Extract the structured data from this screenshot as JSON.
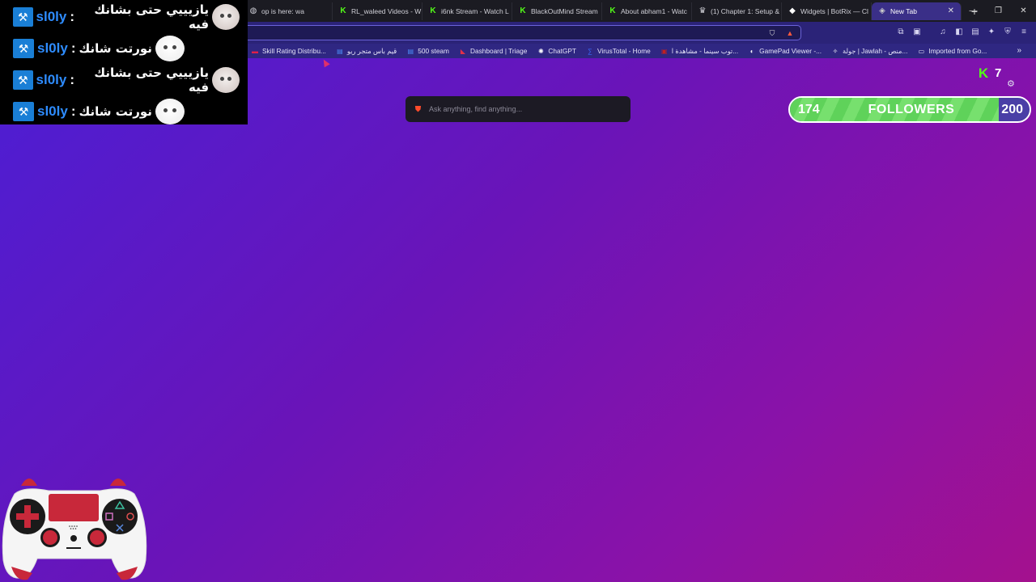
{
  "browser": {
    "tabs": [
      {
        "label": "op is here: wa",
        "icon": "globe-icon",
        "color": "#cfcfd6"
      },
      {
        "label": "RL_waleed Videos - W",
        "icon": "kick-icon",
        "color": "#53fc18"
      },
      {
        "label": "i6nk Stream - Watch L",
        "icon": "kick-icon",
        "color": "#53fc18"
      },
      {
        "label": "BlackOutMind Stream",
        "icon": "kick-icon",
        "color": "#53fc18"
      },
      {
        "label": "About abham1 - Watc",
        "icon": "kick-icon",
        "color": "#53fc18"
      },
      {
        "label": "(1) Chapter 1: Setup &",
        "icon": "crown-icon",
        "color": "#cfcfd6"
      },
      {
        "label": "Widgets | BotRix — Cl",
        "icon": "diamond-icon",
        "color": "#ffffff"
      }
    ],
    "active_tab": {
      "label": "New Tab",
      "close": "✕"
    },
    "new_tab": "+",
    "window_controls": {
      "minimize": "—",
      "restore": "❐",
      "close": "✕"
    }
  },
  "bookmarks": [
    {
      "label": "Skill Rating Distribu...",
      "icon": "tracker-icon",
      "color": "#e0204a"
    },
    {
      "label": "قيم باس متجر ريو",
      "icon": "doc-icon",
      "color": "#4b8bf5"
    },
    {
      "label": "500 steam",
      "icon": "doc-icon",
      "color": "#4b8bf5"
    },
    {
      "label": "Dashboard | Triage",
      "icon": "triage-icon",
      "color": "#e0304a"
    },
    {
      "label": "ChatGPT",
      "icon": "chatgpt-icon",
      "color": "#ffffff"
    },
    {
      "label": "VirusTotal - Home",
      "icon": "virustotal-icon",
      "color": "#3b6cff"
    },
    {
      "label": "توب سينما - مشاهدة ا...",
      "icon": "cinema-icon",
      "color": "#c02020"
    },
    {
      "label": "GamePad Viewer -...",
      "icon": "gamepad-icon",
      "color": "#ffffff"
    },
    {
      "label": "جولة | Jawlah - منص...",
      "icon": "jawlah-icon",
      "color": "#ffffff"
    },
    {
      "label": "Imported from Go...",
      "icon": "folder-icon",
      "color": "#e6e4f8"
    }
  ],
  "bookmarks_more": "»",
  "chat": {
    "messages": [
      {
        "user": "sl0ly",
        "text": "يازيييي حتى بشانك فيه",
        "emote": "cat-emote"
      },
      {
        "user": "sl0ly",
        "text": "نورتت شانك",
        "emote": "white-cat-emote"
      },
      {
        "user": "sl0ly",
        "text": "يازيييي حتى بشانك فيه",
        "emote": "cat-emote"
      },
      {
        "user": "sl0ly",
        "text": "نورتت شانك",
        "emote": "white-cat-emote"
      }
    ],
    "separator": ":"
  },
  "viewers": {
    "count": "7",
    "icon": "kick-logo-icon",
    "color": "#53fc18"
  },
  "followers_goal": {
    "current": "174",
    "label": "FOLLOWERS",
    "target": "200",
    "progress": 0.87,
    "fill_color": "#5fd25a"
  },
  "search": {
    "placeholder": "Ask anything, find anything...",
    "icon": "brave-lion-icon"
  },
  "gamepad": {
    "name": "gamepad-overlay"
  }
}
